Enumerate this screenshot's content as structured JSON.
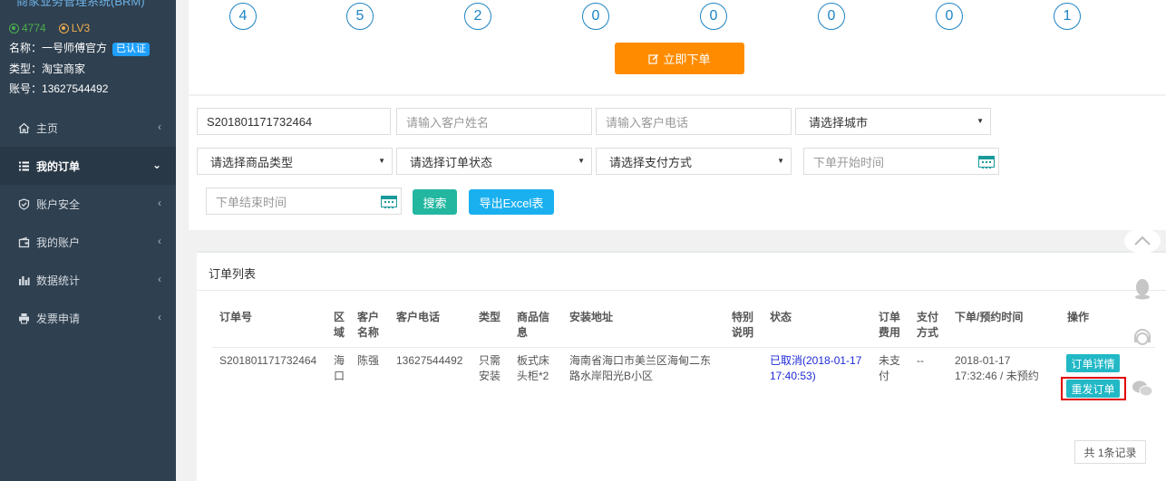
{
  "sidebar": {
    "system_title": "商家业务管理系统(BRM)",
    "coins": "4774",
    "level": "LV3",
    "name_label": "名称：",
    "name_value": "一号师傅官方",
    "verified": "已认证",
    "type_label": "类型：",
    "type_value": "淘宝商家",
    "account_label": "账号：",
    "account_value": "13627544492",
    "items": [
      {
        "label": "主页",
        "icon": "home-icon"
      },
      {
        "label": "我的订单",
        "icon": "list-icon",
        "active": true
      },
      {
        "label": "账户安全",
        "icon": "shield-icon"
      },
      {
        "label": "我的账户",
        "icon": "wallet-icon"
      },
      {
        "label": "数据统计",
        "icon": "bar-chart-icon"
      },
      {
        "label": "发票申请",
        "icon": "printer-icon"
      }
    ]
  },
  "summary_counts": [
    "4",
    "5",
    "2",
    "0",
    "0",
    "0",
    "0",
    "1"
  ],
  "place_order_button": "立即下单",
  "filters": {
    "order_no_value": "S201801171732464",
    "customer_name_placeholder": "请输入客户姓名",
    "customer_phone_placeholder": "请输入客户电话",
    "city_select": "请选择城市",
    "product_type_select": "请选择商品类型",
    "order_status_select": "请选择订单状态",
    "payment_select": "请选择支付方式",
    "start_time_placeholder": "下单开始时间",
    "end_time_placeholder": "下单结束时间",
    "search_button": "搜索",
    "export_button": "导出Excel表"
  },
  "order_list": {
    "title": "订单列表",
    "headers": {
      "order_no": "订单号",
      "region_1": "区",
      "region_2": "域",
      "customer_1": "客户",
      "customer_2": "名称",
      "phone": "客户电话",
      "type": "类型",
      "product_1": "商品信",
      "product_2": "息",
      "address": "安装地址",
      "note_1": "特别",
      "note_2": "说明",
      "status": "状态",
      "fee_1": "订单",
      "fee_2": "费用",
      "pay_1": "支付",
      "pay_2": "方式",
      "time": "下单/预约时间",
      "ops": "操作"
    },
    "row": {
      "order_no": "S201801171732464",
      "region_1": "海",
      "region_2": "口",
      "customer": "陈强",
      "phone": "13627544492",
      "type_1": "只需",
      "type_2": "安装",
      "product_1": "板式床",
      "product_2": "头柜*2",
      "address_1": "海南省海口市美兰区海甸二东",
      "address_2": "路水岸阳光B小区",
      "note": "",
      "status_1": "已取消(2018-01-17",
      "status_2": "17:40:53)",
      "fee_1": "未支",
      "fee_2": "付",
      "pay": "--",
      "time_1": "2018-01-17",
      "time_2": "17:32:46 / 未预约",
      "detail_button": "订单详情",
      "resend_button": "重发订单"
    },
    "total": "共 1条记录"
  }
}
